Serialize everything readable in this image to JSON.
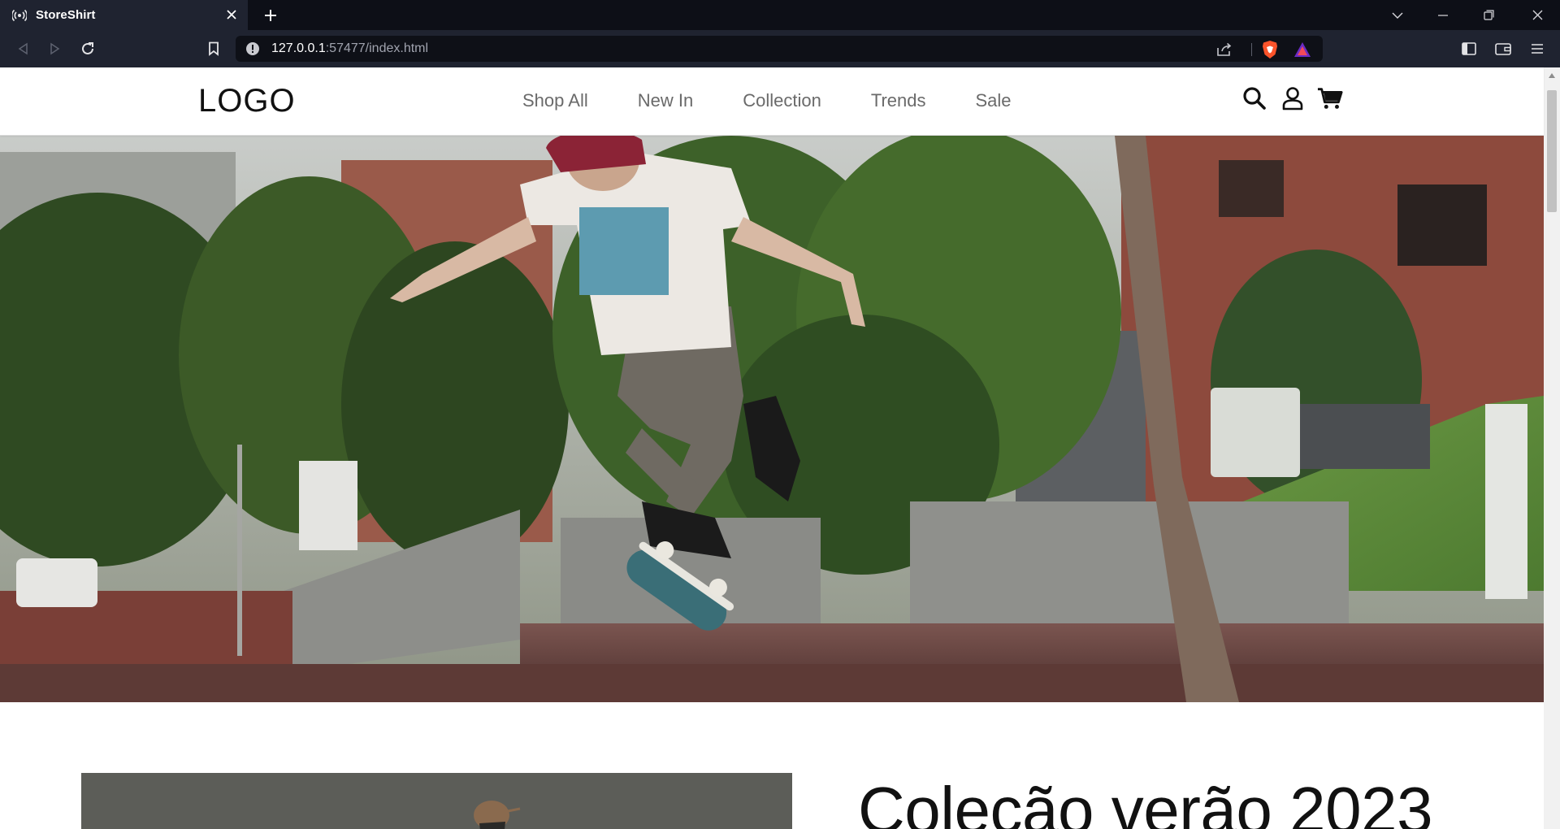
{
  "browser": {
    "tab_title": "StoreShirt",
    "url_host": "127.0.0.1",
    "url_rest": ":57477/index.html",
    "icons": [
      "broadcast-icon",
      "close-icon",
      "plus-icon",
      "chevron-down-icon",
      "minimize-icon",
      "restore-icon",
      "close-window-icon",
      "back-icon",
      "forward-icon",
      "reload-icon",
      "bookmark-icon",
      "info-icon",
      "share-icon",
      "brave-shield-icon",
      "rewards-icon",
      "sidebar-icon",
      "wallet-icon",
      "menu-icon"
    ]
  },
  "site": {
    "logo": "LOGO",
    "nav": [
      {
        "label": "Shop All"
      },
      {
        "label": "New In"
      },
      {
        "label": "Collection"
      },
      {
        "label": "Trends"
      },
      {
        "label": "Sale"
      }
    ],
    "header_icons": [
      "search-icon",
      "user-icon",
      "cart-icon"
    ],
    "hero_alt": "skateboarder-photo",
    "promo_title": "Coleção verão 2023"
  },
  "colors": {
    "chrome_dark": "#0d0f17",
    "chrome_toolbar": "#1f2330",
    "nav_text": "#6a6a6a",
    "logo_text": "#111111"
  }
}
